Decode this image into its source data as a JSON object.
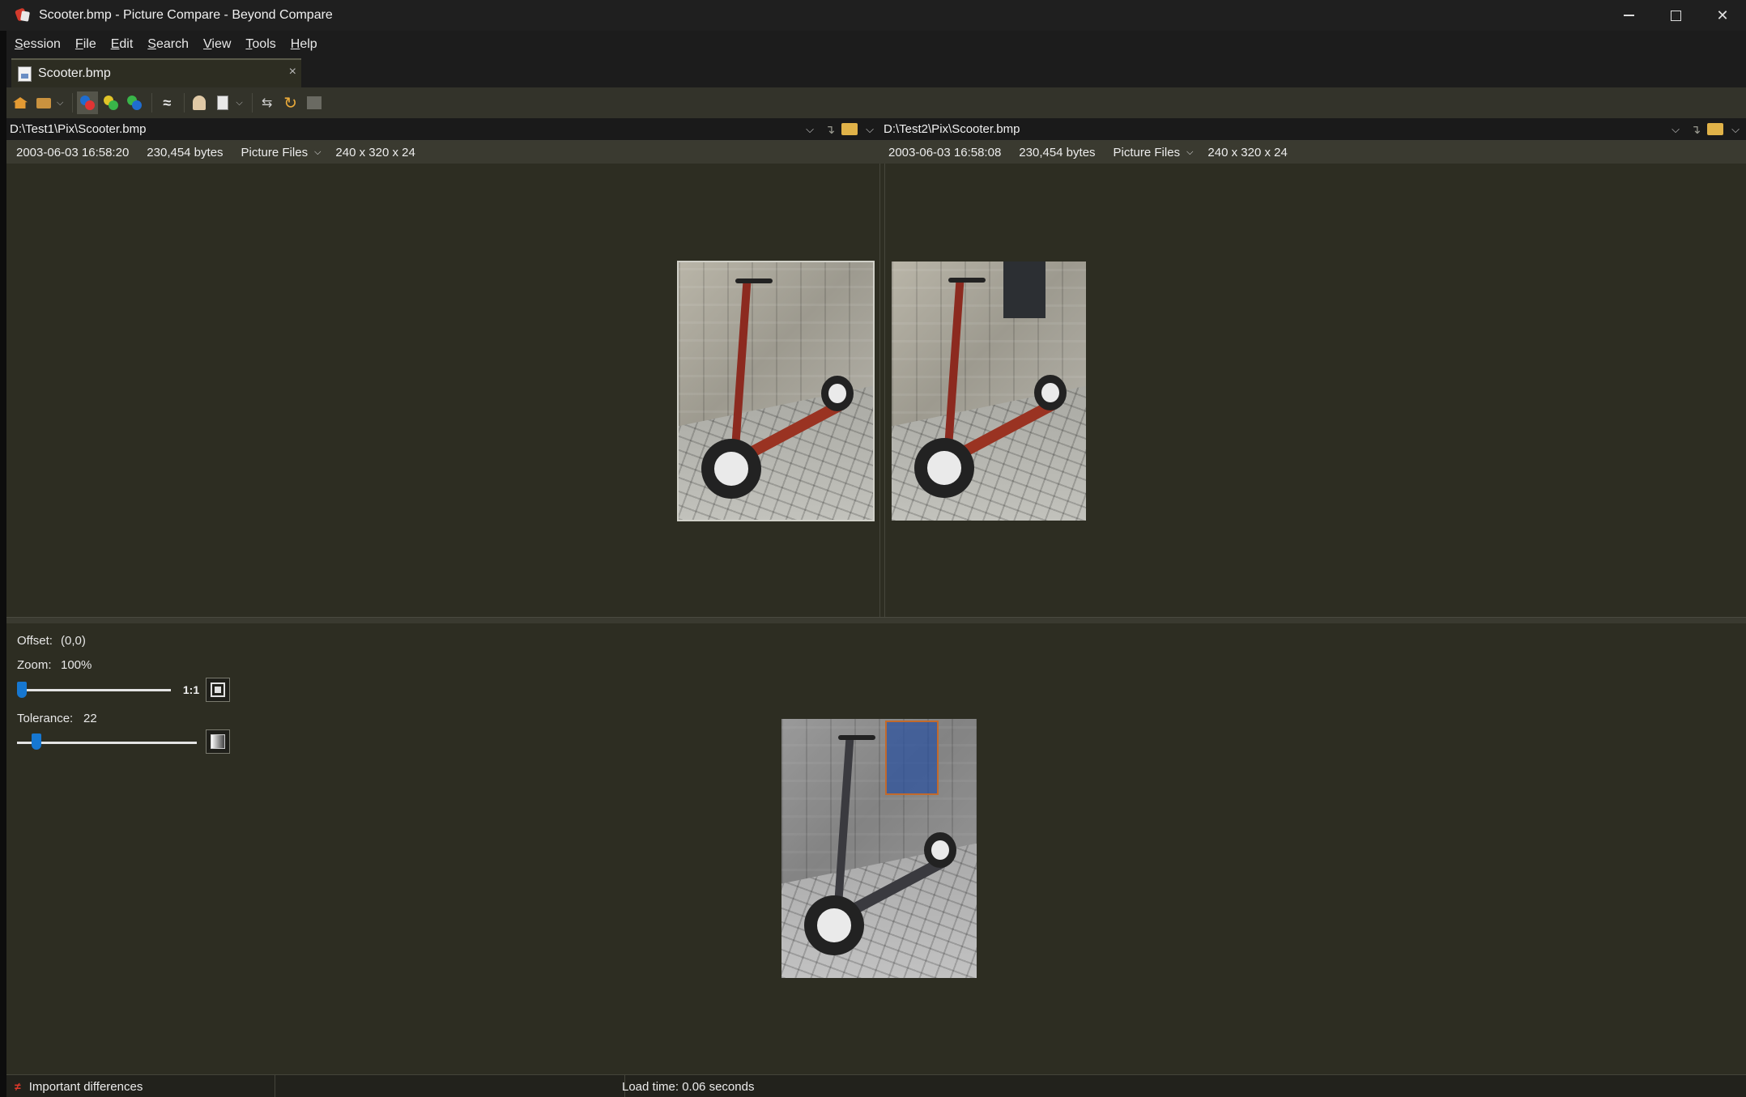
{
  "window": {
    "title": "Scooter.bmp - Picture Compare - Beyond Compare",
    "controls": {
      "minimize": "minimize",
      "maximize": "maximize",
      "close": "✕"
    }
  },
  "menu": [
    {
      "label": "Session",
      "accel": "S",
      "rest": "ession"
    },
    {
      "label": "File",
      "accel": "F",
      "rest": "ile"
    },
    {
      "label": "Edit",
      "accel": "E",
      "rest": "dit"
    },
    {
      "label": "Search",
      "accel": "S",
      "rest": "earch"
    },
    {
      "label": "View",
      "accel": "V",
      "rest": "iew"
    },
    {
      "label": "Tools",
      "accel": "T",
      "rest": "ools"
    },
    {
      "label": "Help",
      "accel": "H",
      "rest": "elp"
    }
  ],
  "tab": {
    "label": "Scooter.bmp",
    "close": "×"
  },
  "toolbar": {
    "icons": [
      "home-icon",
      "briefcase-icon",
      "show-all-icon",
      "show-differences-icon",
      "show-same-icon",
      "rules-icon",
      "person-icon",
      "document-icon",
      "swap-icon",
      "refresh-icon",
      "save-icon"
    ],
    "rules_glyph": "≈",
    "swap_glyph": "⇆",
    "refresh_glyph": "↻"
  },
  "left": {
    "path": "D:\\Test1\\Pix\\Scooter.bmp",
    "date": "2003-06-03 16:58:20",
    "size": "230,454 bytes",
    "format": "Picture Files",
    "dims": "240 x 320 x 24"
  },
  "right": {
    "path": "D:\\Test2\\Pix\\Scooter.bmp",
    "date": "2003-06-03 16:58:08",
    "size": "230,454 bytes",
    "format": "Picture Files",
    "dims": "240 x 320 x 24"
  },
  "controls": {
    "offset_label": "Offset:",
    "offset_value": "(0,0)",
    "zoom_label": "Zoom:",
    "zoom_value": "100%",
    "zoom_level": 0.0,
    "actual_size_label": "1:1",
    "tolerance_label": "Tolerance:",
    "tolerance_value": "22",
    "tolerance_level": 0.1
  },
  "status": {
    "differences": "Important differences",
    "load_time": "Load time: 0.06 seconds"
  },
  "colors": {
    "background": "#2d2d22",
    "accent": "#1677d1",
    "diff_red": "#e0392b"
  }
}
